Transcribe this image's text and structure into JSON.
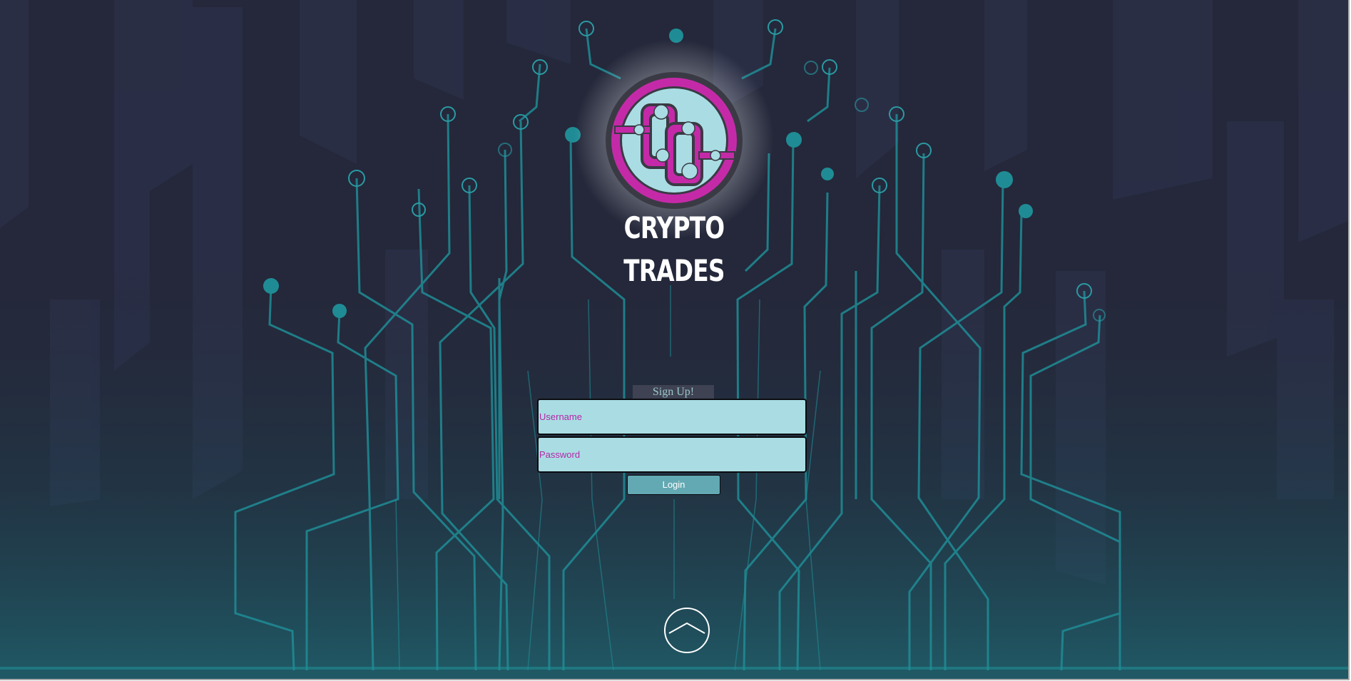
{
  "brand": {
    "name": "CRYPTO TRADES",
    "logo_icon": "chain-link-logo-icon"
  },
  "form": {
    "signup_label": "Sign Up!",
    "username_placeholder": "Username",
    "username_value": "",
    "password_placeholder": "Password",
    "password_value": "",
    "login_label": "Login"
  },
  "scroll_button": {
    "icon": "chevron-up-icon"
  },
  "colors": {
    "background": "#24283a",
    "accent_teal": "#1f8c95",
    "magenta": "#c42aa8",
    "input_fill": "#a9dde3",
    "button_fill": "#63a9b3"
  }
}
